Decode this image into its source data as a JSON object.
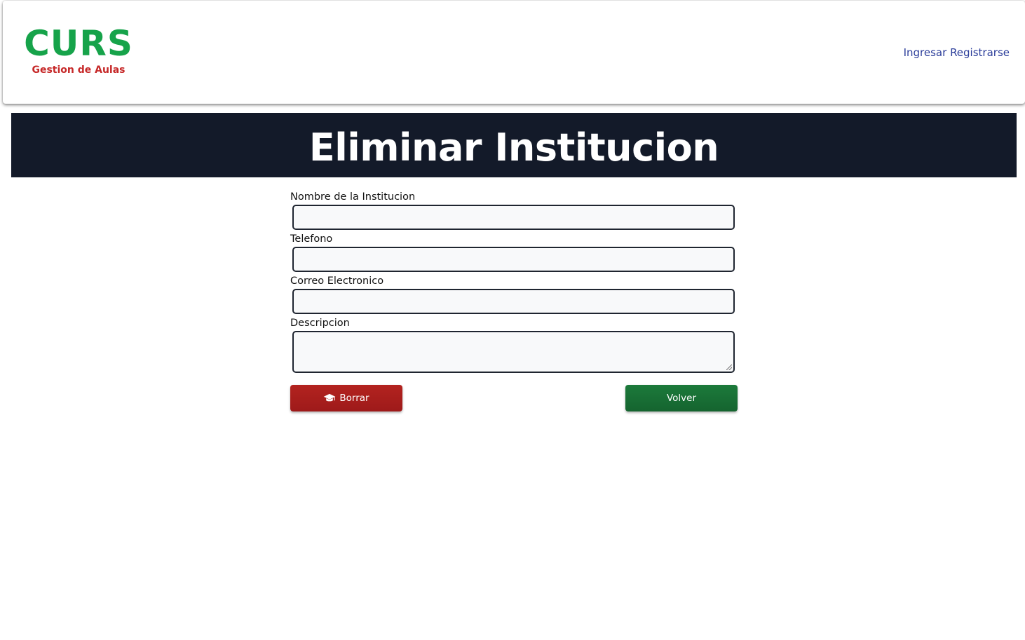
{
  "header": {
    "brand_title": "CURS",
    "brand_subtitle": "Gestion de Aulas",
    "nav": {
      "login_label": "Ingresar",
      "register_label": "Registrarse"
    }
  },
  "banner": {
    "title": "Eliminar Institucion"
  },
  "form": {
    "fields": [
      {
        "label": "Nombre de la Institucion",
        "value": ""
      },
      {
        "label": "Telefono",
        "value": ""
      },
      {
        "label": "Correo Electronico",
        "value": ""
      },
      {
        "label": "Descripcion",
        "value": ""
      }
    ]
  },
  "actions": {
    "delete_label": "Borrar",
    "delete_icon": "graduation-cap-icon",
    "back_label": "Volver"
  },
  "colors": {
    "brand_green": "#16a34a",
    "brand_red": "#c62828",
    "banner_bg": "#131a29",
    "delete_button": "#a61e1e",
    "back_button": "#186f35",
    "nav_link": "#2b3d9a"
  }
}
